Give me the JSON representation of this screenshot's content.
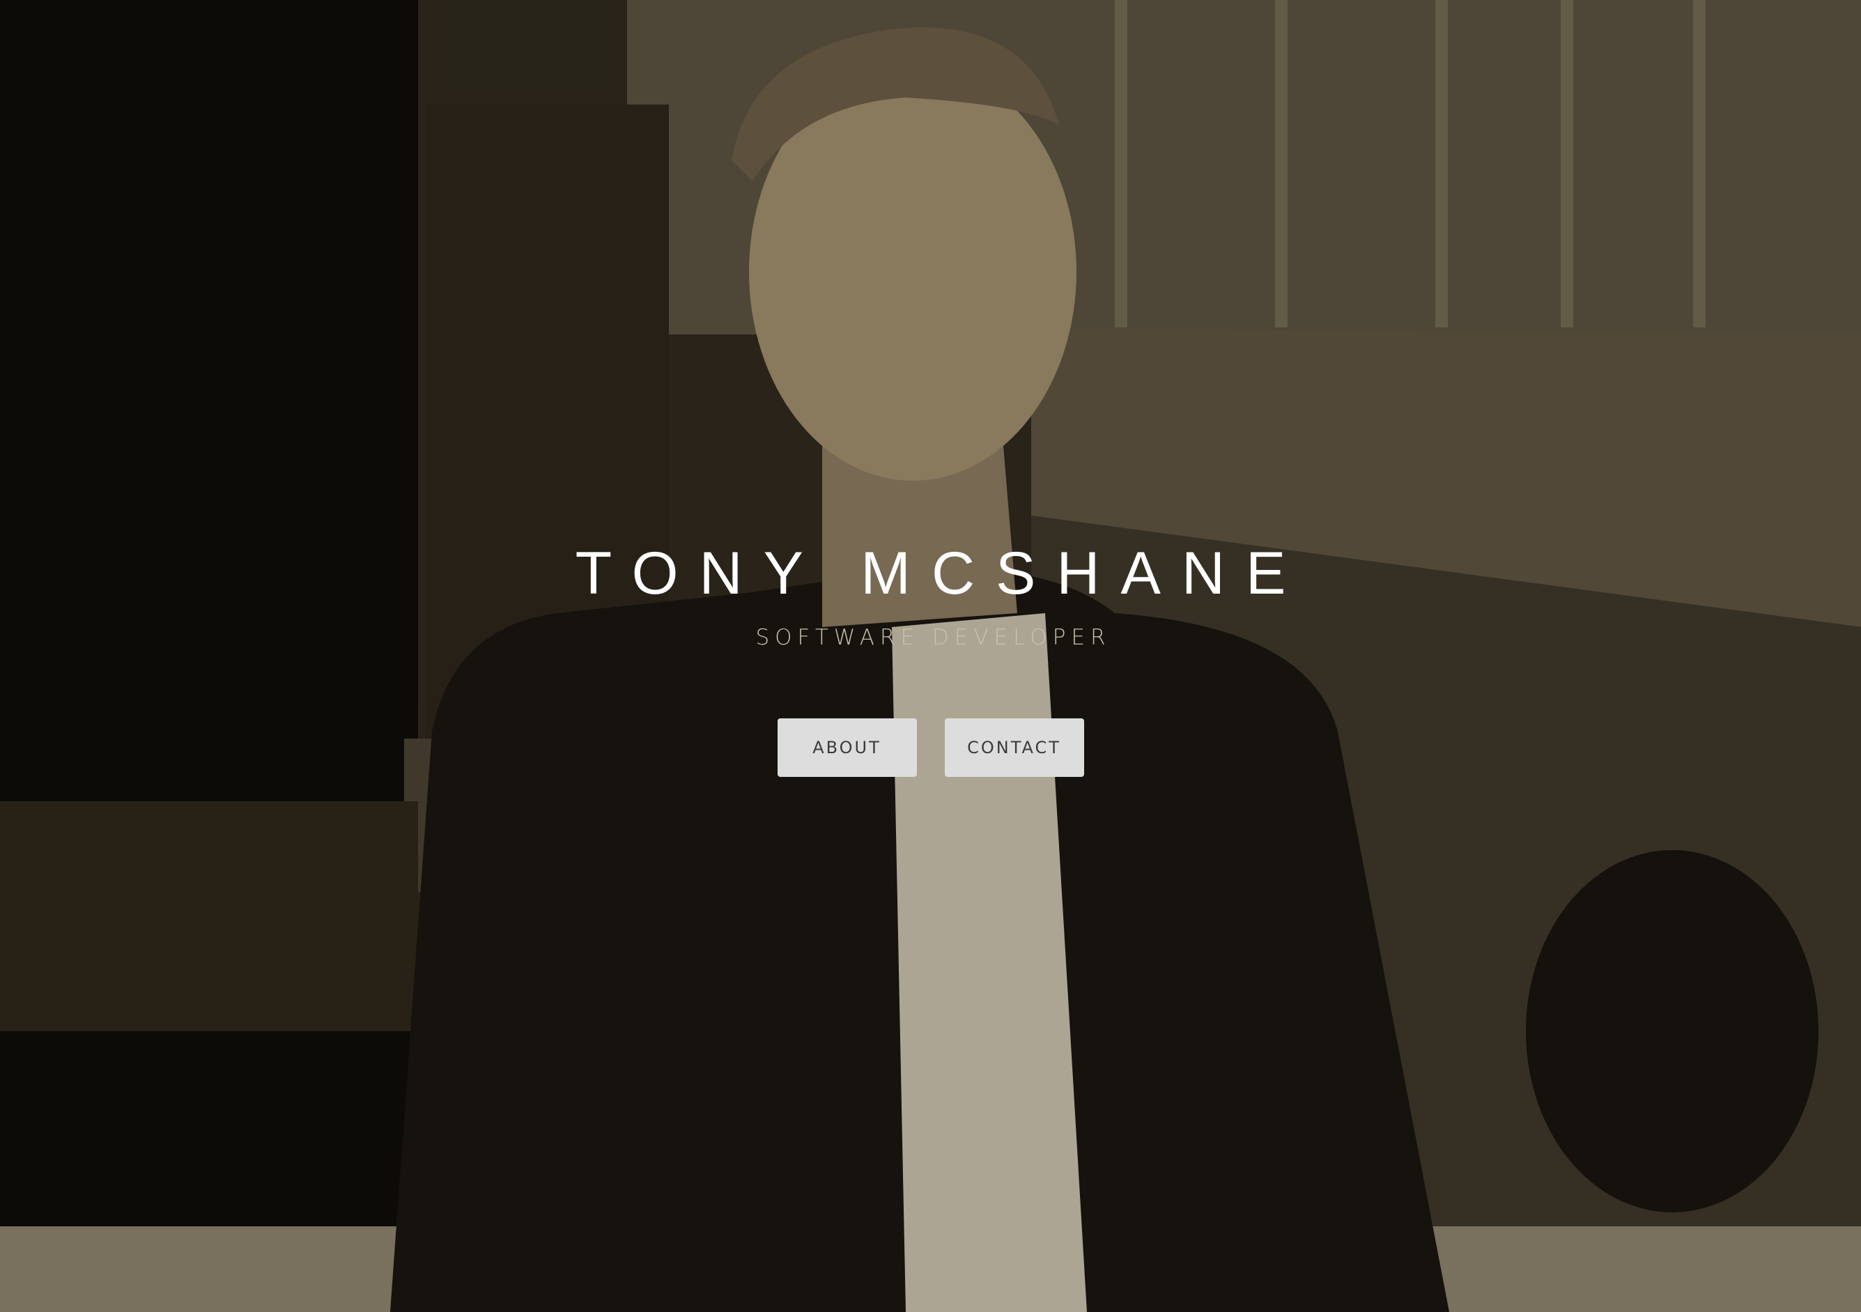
{
  "hero": {
    "background_image": "portrait-photo",
    "tint_color": "#5a5140",
    "name": "TONY MCSHANE",
    "subtitle": "SOFTWARE DEVELOPER"
  },
  "buttons": {
    "about_label": "ABOUT",
    "contact_label": "CONTACT",
    "background_color": "#dddddd",
    "text_color": "#3b3b3b"
  }
}
